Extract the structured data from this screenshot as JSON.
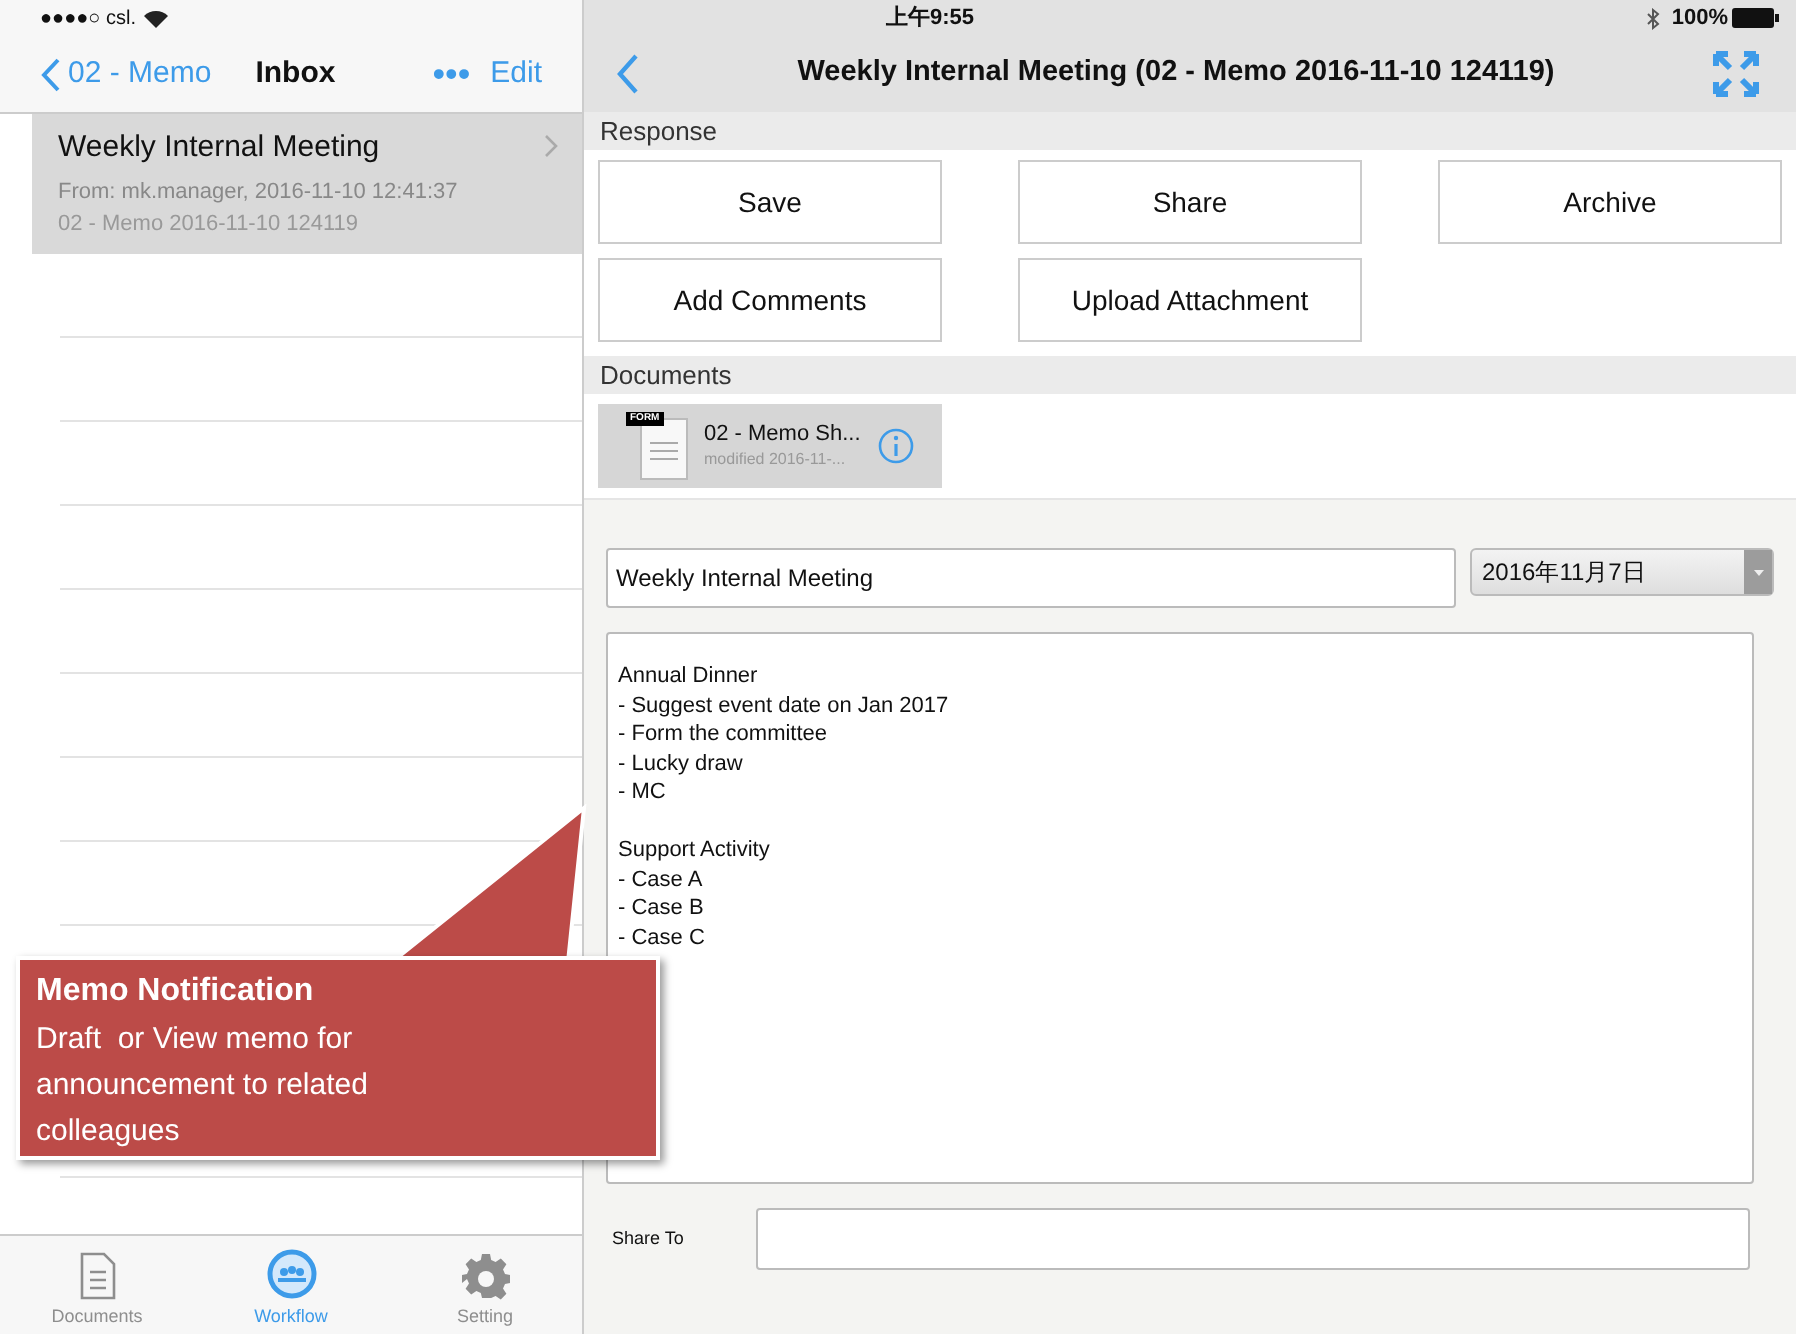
{
  "status_bar": {
    "carrier": "●●●●○ csl.",
    "time": "上午9:55",
    "battery": "100%"
  },
  "master": {
    "back_label": "02 - Memo",
    "title": "Inbox",
    "more": "•••",
    "edit": "Edit",
    "items": [
      {
        "title": "Weekly Internal Meeting",
        "from": "From: mk.manager, 2016-11-10 12:41:37",
        "subtitle": "02 - Memo 2016-11-10 124119",
        "selected": true
      }
    ]
  },
  "tab_bar": [
    {
      "label": "Documents",
      "selected": false
    },
    {
      "label": "Workflow",
      "selected": true
    },
    {
      "label": "Setting",
      "selected": false
    }
  ],
  "detail": {
    "title": "Weekly Internal Meeting (02 - Memo 2016-11-10 124119)",
    "response": {
      "heading": "Response",
      "buttons": [
        "Save",
        "Share",
        "Archive",
        "Add Comments",
        "Upload Attachment"
      ]
    },
    "documents": {
      "heading": "Documents",
      "items": [
        {
          "name": "02 - Memo Sh...",
          "modified": "modified 2016-11-...",
          "badge": "FORM"
        }
      ]
    },
    "form": {
      "title_value": "Weekly Internal Meeting",
      "date_value": "2016年11月7日",
      "body": "Annual Dinner\n- Suggest event date on Jan 2017\n- Form the committee\n- Lucky draw\n- MC\n\nSupport Activity\n- Case A\n- Case B\n- Case C",
      "share_label": "Share To"
    }
  },
  "callout": {
    "title": "Memo Notification",
    "text": "Draft  or View memo for announcement to related colleagues"
  }
}
